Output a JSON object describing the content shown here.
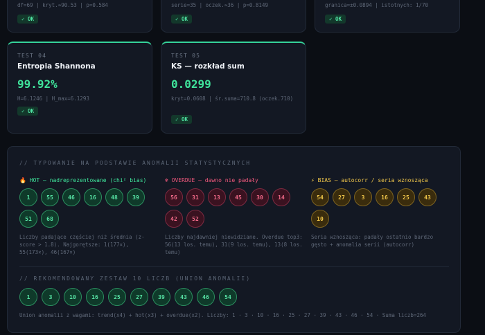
{
  "prev_tests": [
    {
      "detail": "df=69 | kryt.≈90.53 | p=0.584",
      "badge": "✓ OK"
    },
    {
      "detail": "serie=35 | oczek.≈36 | p=0.8149",
      "badge": "✓ OK"
    },
    {
      "detail": "granica=±0.0894 | istotnych: 1/70",
      "badge": "✓ OK"
    }
  ],
  "tests": [
    {
      "label": "TEST 04",
      "title": "Entropia Shannona",
      "value": "99.92%",
      "detail": "H=6.1246 | H_max=6.1293",
      "badge": "✓ OK"
    },
    {
      "label": "TEST 05",
      "title": "KS — rozkład sum",
      "value": "0.0299",
      "detail": "kryt=0.0608 | śr.suma=710.8 (oczek.710)",
      "badge": "✓ OK"
    }
  ],
  "anomalies": {
    "title": "// TYPOWANIE NA PODSTAWIE ANOMALII STATYSTYCZNYCH",
    "hot": {
      "icon": "fire-icon",
      "heading": "🔥 HOT — nadreprezentowane (chi² bias)",
      "color": "#3fe39b",
      "numbers": [
        "1",
        "55",
        "46",
        "16",
        "48",
        "39",
        "51",
        "68"
      ],
      "note": "Liczby padające częściej niż średnia (z-score > 1.8). Najgorętsze: 1(177×), 55(173×), 46(167×)"
    },
    "overdue": {
      "icon": "clock-icon",
      "heading": "❄ OVERDUE — dawno nie padały",
      "color": "#f0587c",
      "numbers": [
        "56",
        "31",
        "13",
        "45",
        "30",
        "14",
        "42",
        "52"
      ],
      "note": "Liczby najdawniej niewidziane. Overdue top3: 56(13 los. temu), 31(9 los. temu), 13(8 los. temu)"
    },
    "bias": {
      "icon": "bolt-icon",
      "heading": "⚡ BIAS — autocorr / seria wznosząca",
      "color": "#f0c64a",
      "numbers": [
        "54",
        "27",
        "3",
        "16",
        "25",
        "43",
        "10"
      ],
      "note": "Seria wznosząca: padały ostatnio bardzo gęsto + anomalia serii (autocorr)"
    }
  },
  "recommended": {
    "title": "// REKOMENDOWANY ZESTAW 10 LICZB (UNION ANOMALII)",
    "numbers": [
      "1",
      "3",
      "10",
      "16",
      "25",
      "27",
      "39",
      "43",
      "46",
      "54"
    ],
    "note": "Union anomalii z wagami: trend(x4) + hot(x3) + overdue(x2). Liczby: 1 · 3 · 10 · 16 · 25 · 27 · 39 · 43 · 46 · 54 · Suma liczb=264"
  }
}
